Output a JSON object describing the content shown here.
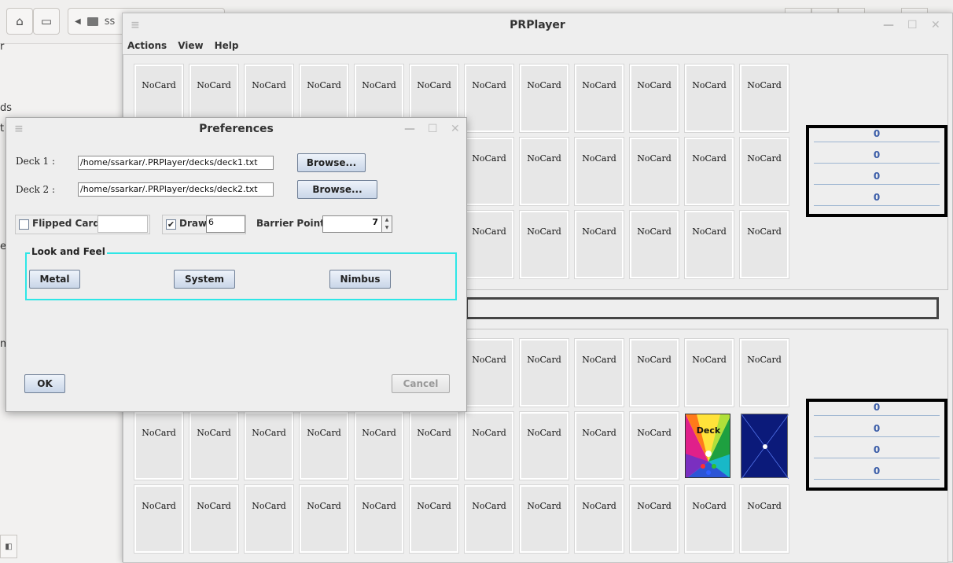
{
  "file_manager": {
    "path_label": "ss",
    "sidebar_items": [
      "r",
      "ds",
      "t",
      "er",
      "m"
    ]
  },
  "player": {
    "title": "PRPlayer",
    "menu": [
      "Actions",
      "View",
      "Help"
    ],
    "empty_card_label": "NoCard",
    "top_scores": [
      "0",
      "0",
      "0",
      "0"
    ],
    "bottom_scores": [
      "0",
      "0",
      "0",
      "0"
    ],
    "deck_label": "Deck"
  },
  "preferences": {
    "title": "Preferences",
    "deck1_label": "Deck 1 :",
    "deck1_path": "/home/ssarkar/.PRPlayer/decks/deck1.txt",
    "deck2_label": "Deck 2 :",
    "deck2_path": "/home/ssarkar/.PRPlayer/decks/deck2.txt",
    "browse_label": "Browse...",
    "flipped_cards_label": "Flipped Cards",
    "flipped_cards_checked": false,
    "flipped_cards_value": "",
    "draw_label": "Draw",
    "draw_checked": true,
    "draw_value": "6",
    "barrier_points_label": "Barrier Points",
    "barrier_points_value": "7",
    "look_and_feel_label": "Look and Feel",
    "look_and_feel_options": [
      "Metal",
      "System",
      "Nimbus"
    ],
    "ok_label": "OK",
    "cancel_label": "Cancel"
  }
}
